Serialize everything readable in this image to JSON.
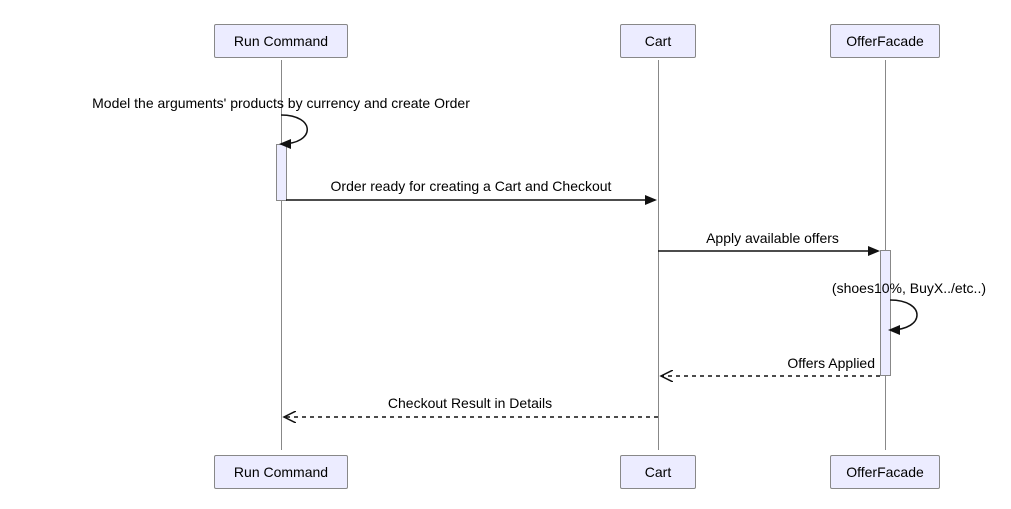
{
  "participants": {
    "p1": "Run Command",
    "p2": "Cart",
    "p3": "OfferFacade"
  },
  "messages": {
    "m1": "Model the arguments' products by currency and create Order",
    "m2": "Order ready for creating a Cart and Checkout",
    "m3": "Apply available offers",
    "m4": "(shoes10%, BuyX../etc..)",
    "m5": "Offers Applied",
    "m6": "Checkout Result in Details"
  },
  "chart_data": {
    "type": "sequence-diagram",
    "participants": [
      "Run Command",
      "Cart",
      "OfferFacade"
    ],
    "interactions": [
      {
        "from": "Run Command",
        "to": "Run Command",
        "label": "Model the arguments' products by currency and create Order",
        "style": "solid",
        "self": true
      },
      {
        "from": "Run Command",
        "to": "Cart",
        "label": "Order ready for creating a Cart and Checkout",
        "style": "solid"
      },
      {
        "from": "Cart",
        "to": "OfferFacade",
        "label": "Apply available offers",
        "style": "solid"
      },
      {
        "from": "OfferFacade",
        "to": "OfferFacade",
        "label": "(shoes10%, BuyX../etc..)",
        "style": "solid",
        "self": true
      },
      {
        "from": "OfferFacade",
        "to": "Cart",
        "label": "Offers Applied",
        "style": "dashed"
      },
      {
        "from": "Cart",
        "to": "Run Command",
        "label": "Checkout Result in Details",
        "style": "dashed"
      }
    ]
  }
}
